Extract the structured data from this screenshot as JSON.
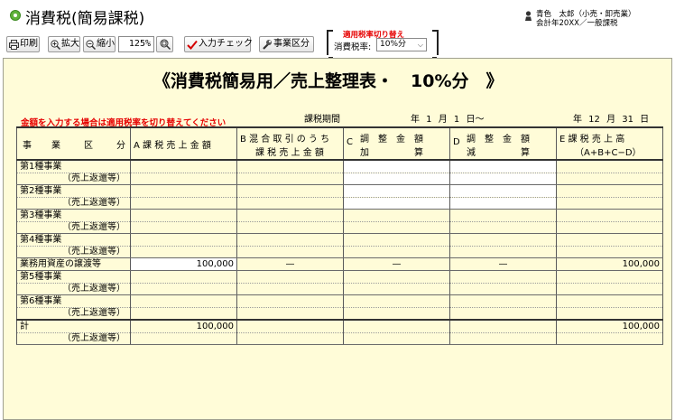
{
  "window": {
    "title": "消費税(簡易課税)",
    "user_line1": "青色　太郎（小売・卸売業）",
    "user_line2": "会計年20XX／一般課税"
  },
  "toolbar": {
    "print_label": "印刷",
    "zoom_in_label": "拡大",
    "zoom_out_label": "縮小",
    "zoom_value": "125%",
    "input_check_label": "入力チェック",
    "business_category_label": "事業区分",
    "rate_switch_title": "適用税率切り替え",
    "rate_label": "消費税率:",
    "rate_selected": "10%分"
  },
  "sheet": {
    "title": "《消費税簡易用／売上整理表・　10%分　》",
    "warning": "金額を入力する場合は適用税率を切り替えてください",
    "period_label": "課税期間",
    "period_start": "年 1 月 1 日～",
    "period_end": "年 12 月 31 日",
    "headers": {
      "col0_a": "事",
      "col0_b": "業",
      "col0_c": "区",
      "col0_d": "分",
      "colA": "A 課 税 売 上 金 額",
      "colB_line1": "B 混 合 取 引 の う ち",
      "colB_line2": "課 税 売 上 金 額",
      "colC_prefix": "C",
      "colC_line1": "調　整　金　額",
      "colC_line2": "加　　　　　算",
      "colD_prefix": "D",
      "colD_line1": "調　整　金　額",
      "colD_line2": "減　　　　　算",
      "colE_line1": "E 課 税 売 上 高",
      "colE_line2": "（A+B+C−D）"
    },
    "rows": [
      {
        "name": "第1種事業",
        "sub": "（売上返還等）"
      },
      {
        "name": "第2種事業",
        "sub": "（売上返還等）"
      },
      {
        "name": "第3種事業",
        "sub": "（売上返還等）"
      },
      {
        "name": "第4種事業",
        "sub": null
      },
      {
        "name": "業務用資産の譲渡等",
        "a": "100,000",
        "b": "—",
        "c": "—",
        "d": "—",
        "e": "100,000"
      },
      {
        "name": "第5種事業",
        "sub": "（売上返還等）"
      },
      {
        "name": "第6種事業",
        "sub": "（売上返還等）"
      },
      {
        "name": "計",
        "a": "100,000",
        "e": "100,000",
        "sub": "（売上返還等）"
      }
    ],
    "row4_sub": "（売上返還等）"
  }
}
